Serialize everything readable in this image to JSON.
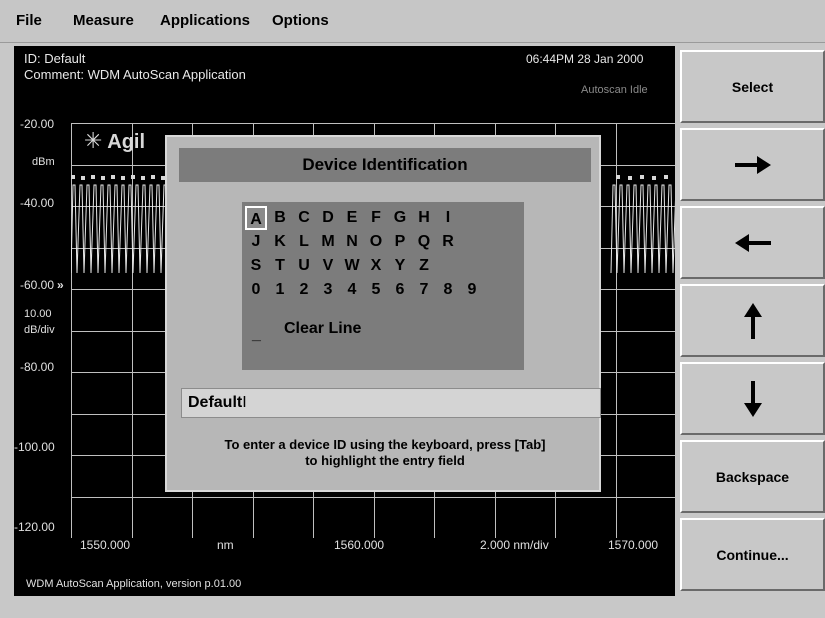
{
  "menu": {
    "file": "File",
    "measure": "Measure",
    "applications": "Applications",
    "options": "Options"
  },
  "screen": {
    "id_line": "ID: Default",
    "comment_line": "Comment: WDM AutoScan Application",
    "timestamp": "06:44PM 28 Jan 2000",
    "scan_status": "Autoscan Idle",
    "logo_text": "Agil",
    "y_ticks": [
      "-20.00",
      "-40.00",
      "-60.00",
      "-80.00",
      "-100.00",
      "-120.00"
    ],
    "y_unit": "dBm",
    "scale": "10.00",
    "scale_unit": "dB/div",
    "ref_marker": "»",
    "x_start": "1550.000",
    "x_unit": "nm",
    "x_center": "1560.000",
    "x_per_div": "2.000 nm/div",
    "x_end": "1570.000",
    "version": "WDM AutoScan Application, version p.01.00"
  },
  "dialog": {
    "title": "Device Identification",
    "keys": [
      [
        "A",
        "B",
        "C",
        "D",
        "E",
        "F",
        "G",
        "H",
        "I"
      ],
      [
        "J",
        "K",
        "L",
        "M",
        "N",
        "O",
        "P",
        "Q",
        "R"
      ],
      [
        "S",
        "T",
        "U",
        "V",
        "W",
        "X",
        "Y",
        "Z"
      ],
      [
        "0",
        "1",
        "2",
        "3",
        "4",
        "5",
        "6",
        "7",
        "8",
        "9"
      ]
    ],
    "selected_key": "A",
    "underscore": "_",
    "clear_line": "Clear Line",
    "entry_value": "Default",
    "instruction_line1": "To enter a device ID using the keyboard, press [Tab]",
    "instruction_line2": "to highlight the entry field"
  },
  "softkeys": {
    "select": "Select",
    "right": "right-arrow-icon",
    "left": "left-arrow-icon",
    "up": "up-arrow-icon",
    "down": "down-arrow-icon",
    "backspace": "Backspace",
    "continue": "Continue..."
  }
}
